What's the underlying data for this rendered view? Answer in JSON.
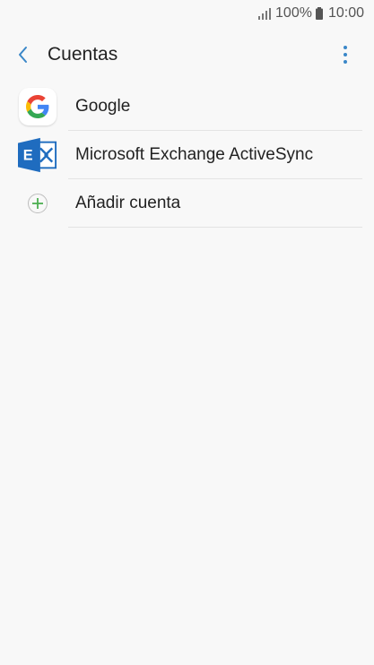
{
  "status_bar": {
    "battery_percent": "100%",
    "time": "10:00"
  },
  "app_bar": {
    "title": "Cuentas",
    "back_icon": "chevron-left-icon",
    "more_icon": "more-vert-icon"
  },
  "accounts": [
    {
      "label": "Google",
      "icon": "google-icon"
    },
    {
      "label": "Microsoft Exchange ActiveSync",
      "icon": "exchange-icon"
    },
    {
      "label": "Añadir cuenta",
      "icon": "add-circle-icon"
    }
  ],
  "colors": {
    "accent": "#3a87c8",
    "add_green": "#4caf50",
    "exchange_blue": "#1f6cbf",
    "background": "#f8f8f8"
  }
}
